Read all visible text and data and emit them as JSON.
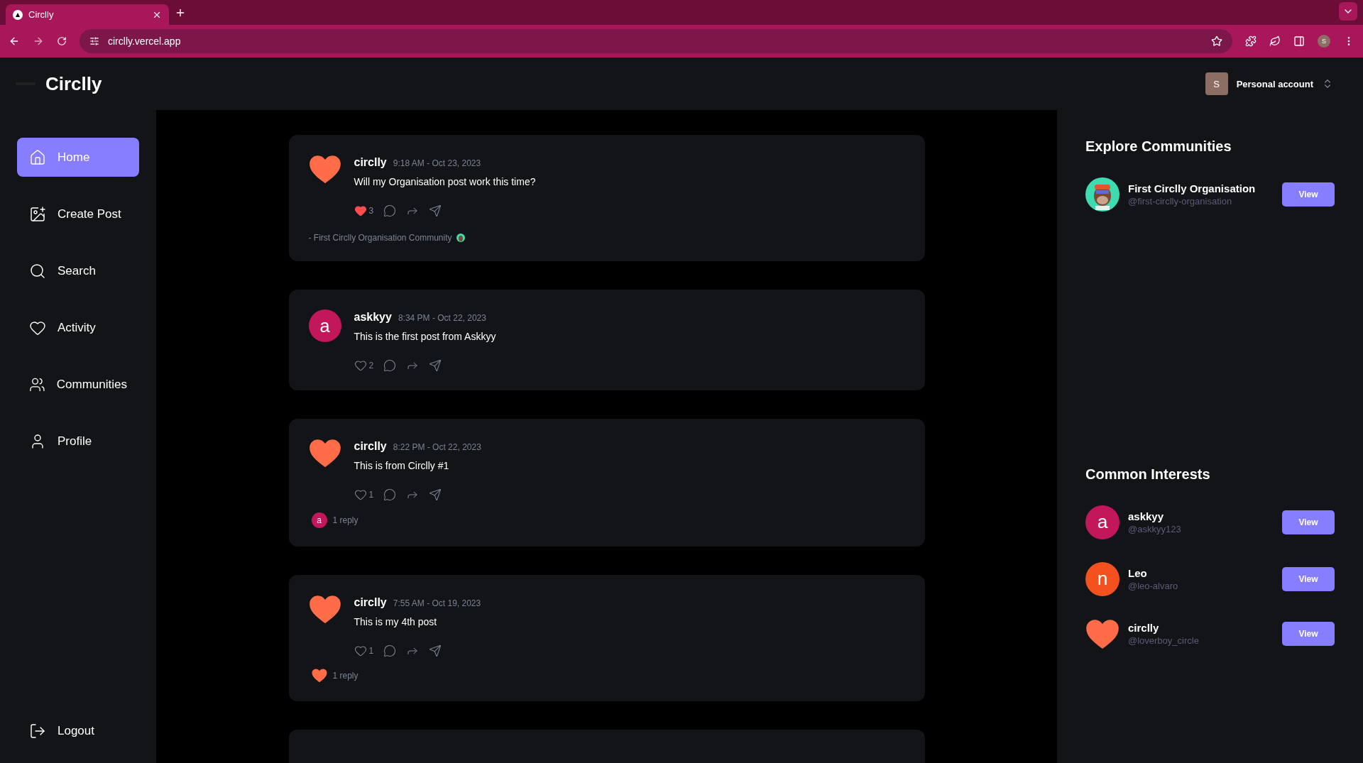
{
  "browser": {
    "tab_title": "Circlly",
    "url": "circlly.vercel.app",
    "profile_initial": "S"
  },
  "header": {
    "logo": "Circlly",
    "account": {
      "initial": "S",
      "label": "Personal account"
    }
  },
  "sidebar": {
    "items": [
      {
        "label": "Home",
        "kind": "home",
        "selected": true
      },
      {
        "label": "Create Post",
        "kind": "create",
        "selected": false
      },
      {
        "label": "Search",
        "kind": "search",
        "selected": false
      },
      {
        "label": "Activity",
        "kind": "activity",
        "selected": false
      },
      {
        "label": "Communities",
        "kind": "communities",
        "selected": false
      },
      {
        "label": "Profile",
        "kind": "profile",
        "selected": false
      }
    ],
    "logout": "Logout"
  },
  "posts": [
    {
      "author": "circlly",
      "avatar": {
        "kind": "heart"
      },
      "time": "9:18 AM - Oct 23, 2023",
      "text": "Will my Organisation post work this time?",
      "liked": true,
      "likes": "3",
      "community": "- First Circlly Organisation Community"
    },
    {
      "author": "askkyy",
      "avatar": {
        "kind": "letter",
        "letter": "a",
        "color": "#c2185b"
      },
      "time": "8:34 PM - Oct 22, 2023",
      "text": "This is the first post from Askkyy",
      "liked": false,
      "likes": "2"
    },
    {
      "author": "circlly",
      "avatar": {
        "kind": "heart"
      },
      "time": "8:22 PM - Oct 22, 2023",
      "text": "This is from Circlly #1",
      "liked": false,
      "likes": "1",
      "reply": {
        "avatar": {
          "kind": "letter",
          "letter": "a",
          "color": "#c2185b"
        },
        "label": "1 reply"
      }
    },
    {
      "author": "circlly",
      "avatar": {
        "kind": "heart"
      },
      "time": "7:55 AM - Oct 19, 2023",
      "text": "This is my 4th post",
      "liked": false,
      "likes": "1",
      "reply": {
        "avatar": {
          "kind": "heart"
        },
        "label": "1 reply"
      }
    }
  ],
  "explore_communities": {
    "title": "Explore Communities",
    "items": [
      {
        "name": "First Circlly Organisation",
        "handle": "@first-circlly-organisation",
        "avatar": {
          "kind": "image"
        },
        "button": "View"
      }
    ]
  },
  "common_interests": {
    "title": "Common Interests",
    "items": [
      {
        "name": "askkyy",
        "handle": "@askkyy123",
        "avatar": {
          "kind": "letter",
          "letter": "a",
          "color": "#c2185b"
        },
        "button": "View"
      },
      {
        "name": "Leo",
        "handle": "@leo-alvaro",
        "avatar": {
          "kind": "letter",
          "letter": "n",
          "color": "#f4511e"
        },
        "button": "View"
      },
      {
        "name": "circlly",
        "handle": "@loverboy_circle",
        "avatar": {
          "kind": "heart"
        },
        "button": "View"
      }
    ]
  }
}
